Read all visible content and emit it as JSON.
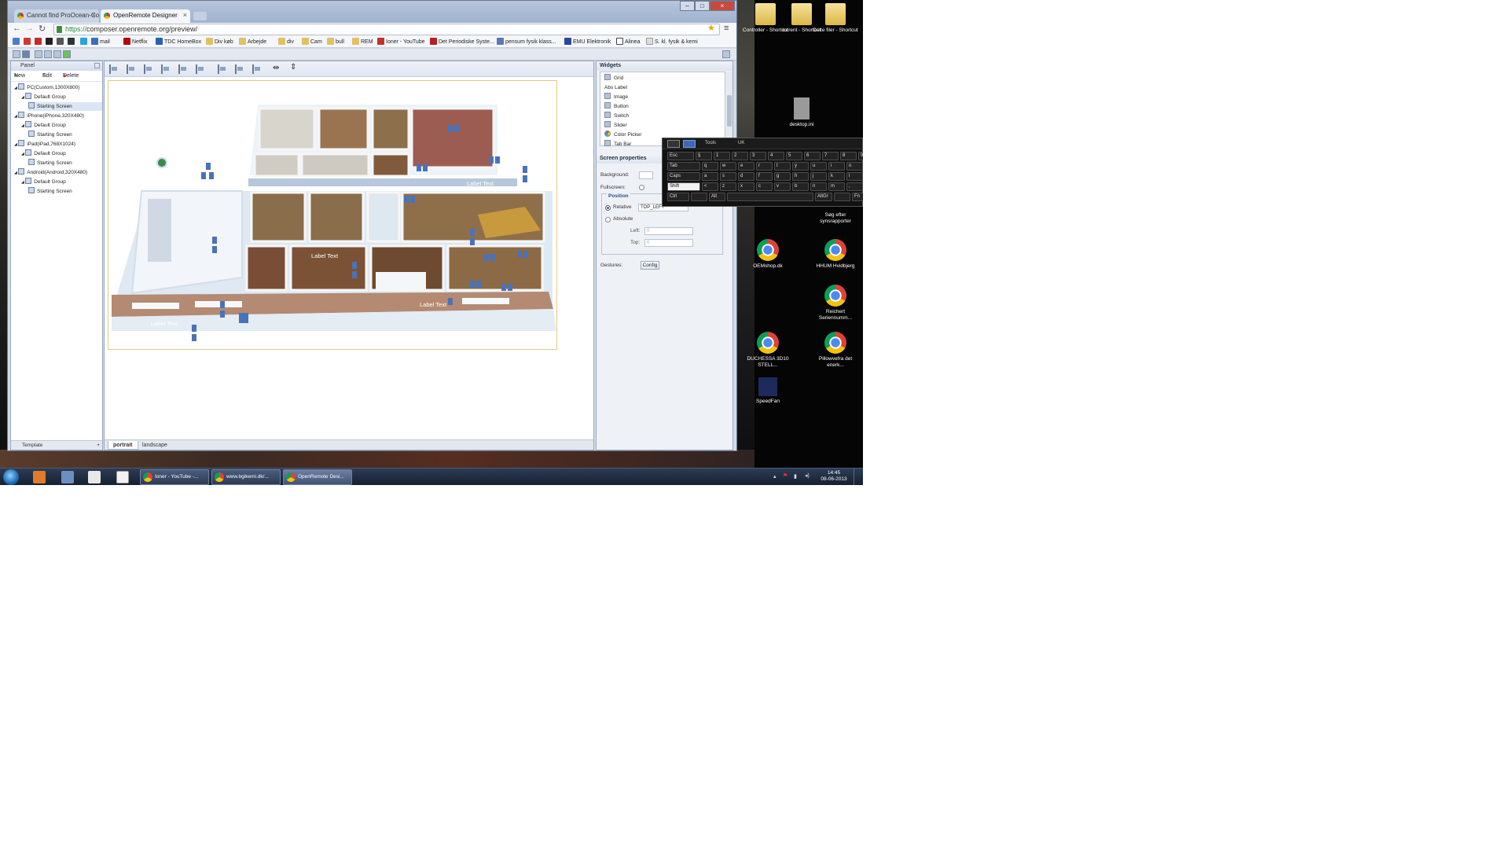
{
  "browser": {
    "tabs": [
      {
        "label": "Cannot find ProOcean-Con",
        "active": false
      },
      {
        "label": "OpenRemote Designer",
        "active": true
      }
    ],
    "url_scheme": "https://",
    "url_rest": "composer.openremote.org/preview/",
    "bookmarks": [
      "mail",
      "Netflix",
      "TDC HomeBox",
      "Div køb",
      "Arbejde",
      "div",
      "Cam",
      "bull",
      "REM",
      "Ioner - YouTube",
      "Det Periodiske Syste...",
      "pensum fysik klass...",
      "EMU Elektronik",
      "Alinea",
      "S. kl. fysik & kemi"
    ]
  },
  "left_panel": {
    "title": "Panel",
    "actions": {
      "new": "New",
      "edit": "Edit",
      "delete": "Delete"
    },
    "tree": [
      {
        "label": "PC(Custom,1300X800)",
        "indent": 0
      },
      {
        "label": "Default Group",
        "indent": 1
      },
      {
        "label": "Starting Screen",
        "indent": 2,
        "selected": true
      },
      {
        "label": "iPhone(iPhone,320X480)",
        "indent": 0
      },
      {
        "label": "Default Group",
        "indent": 1
      },
      {
        "label": "Starting Screen",
        "indent": 2
      },
      {
        "label": "iPad(iPad,768X1024)",
        "indent": 0
      },
      {
        "label": "Default Group",
        "indent": 1
      },
      {
        "label": "Starting Screen",
        "indent": 2
      },
      {
        "label": "Android(Android,320X480)",
        "indent": 0
      },
      {
        "label": "Default Group",
        "indent": 1
      },
      {
        "label": "Starting Screen",
        "indent": 2
      }
    ],
    "footer": "Template"
  },
  "canvas": {
    "labels": [
      "Label Text",
      "Label Text",
      "Label Text",
      "Label Text"
    ]
  },
  "bottom_tabs": [
    "portrait",
    "landscape"
  ],
  "widgets": {
    "title": "Widgets",
    "items": [
      "Grid",
      "Abs Label",
      "Image",
      "Button",
      "Switch",
      "Slider",
      "Color Picker",
      "Tab Bar"
    ]
  },
  "screen_properties": {
    "title": "Screen properties",
    "background_label": "Background:",
    "fullscreen_label": "Fullscreen:",
    "position_label": "Position",
    "relative_label": "Relative",
    "relative_value": "TOP_LEFT",
    "absolute_label": "Absolute",
    "left_label": "Left:",
    "left_value": "0",
    "top_label": "Top:",
    "top_value": "0",
    "gestures_label": "Gestures:",
    "config_button": "Config"
  },
  "keyboard": {
    "mode_label": "Tools",
    "lang": "UK",
    "rows": [
      [
        "Esc",
        "§",
        "1",
        "2",
        "3",
        "4",
        "5",
        "6",
        "7",
        "8",
        "9"
      ],
      [
        "Tab",
        "q",
        "w",
        "e",
        "r",
        "t",
        "y",
        "u",
        "i",
        "o"
      ],
      [
        "Caps",
        "a",
        "s",
        "d",
        "f",
        "g",
        "h",
        "j",
        "k",
        "l"
      ],
      [
        "Shift",
        "<",
        "z",
        "x",
        "c",
        "v",
        "b",
        "n",
        "m",
        ","
      ],
      [
        "Ctrl",
        "",
        "Alt",
        "",
        "AltGr",
        "",
        "Fn"
      ]
    ]
  },
  "desktop_icons": [
    {
      "label": "Controller - Shortcut",
      "type": "folder"
    },
    {
      "label": "torrent - Shortcut",
      "type": "folder"
    },
    {
      "label": "Delte filer - Shortcut",
      "type": "folder"
    },
    {
      "label": "desktop.ini",
      "type": "file"
    },
    {
      "label": "Søg efter synsrapporter",
      "type": "folder"
    },
    {
      "label": "OEMshop.dk",
      "type": "chrome"
    },
    {
      "label": "HHUM Hvidbjerg",
      "type": "chrome"
    },
    {
      "label": "Reichert Seriennumm...",
      "type": "chrome"
    },
    {
      "label": "DUCHESSA 3D10 STELL...",
      "type": "chrome"
    },
    {
      "label": "Pillowvefra det enerk...",
      "type": "chrome"
    },
    {
      "label": "SpeedFan",
      "type": "app"
    }
  ],
  "taskbar": {
    "tasks": [
      {
        "label": "Ioner - YouTube -...",
        "active": false
      },
      {
        "label": "www.bgikemi.dk/...",
        "active": false
      },
      {
        "label": "OpenRemote Desi...",
        "active": true
      }
    ],
    "time": "14:45",
    "date": "08-06-2013"
  },
  "colors": {
    "accent": "#3e6db5",
    "canvas_border": "#e2c98a",
    "keyboard_bg": "#111111"
  }
}
